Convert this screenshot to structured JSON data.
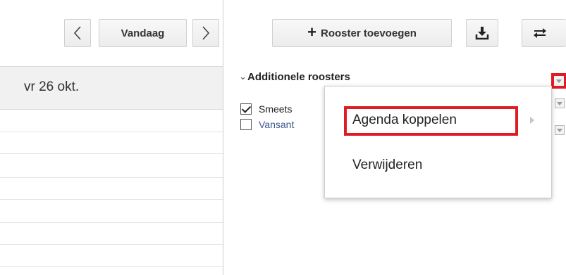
{
  "left_toolbar": {
    "prev_label": "<",
    "today_label": "Vandaag",
    "next_label": ">"
  },
  "day_header": {
    "label": "vr 26 okt."
  },
  "right_toolbar": {
    "add_label": "Rooster toevoegen",
    "add_icon": "plus-icon",
    "download_icon": "download-icon",
    "sync_icon": "swap-icon"
  },
  "section": {
    "title": "Additionele roosters",
    "chevron": "⌄"
  },
  "calendars": [
    {
      "name": "Smeets",
      "checked": true
    },
    {
      "name": "Vansant",
      "checked": false
    }
  ],
  "context_menu": {
    "items": [
      {
        "label": "Agenda koppelen",
        "has_submenu": true
      },
      {
        "label": "Verwijderen",
        "has_submenu": false
      }
    ]
  },
  "colors": {
    "highlight": "#e01b24",
    "header_bg": "#f1f1f1",
    "link_text": "#3c5a8a"
  }
}
